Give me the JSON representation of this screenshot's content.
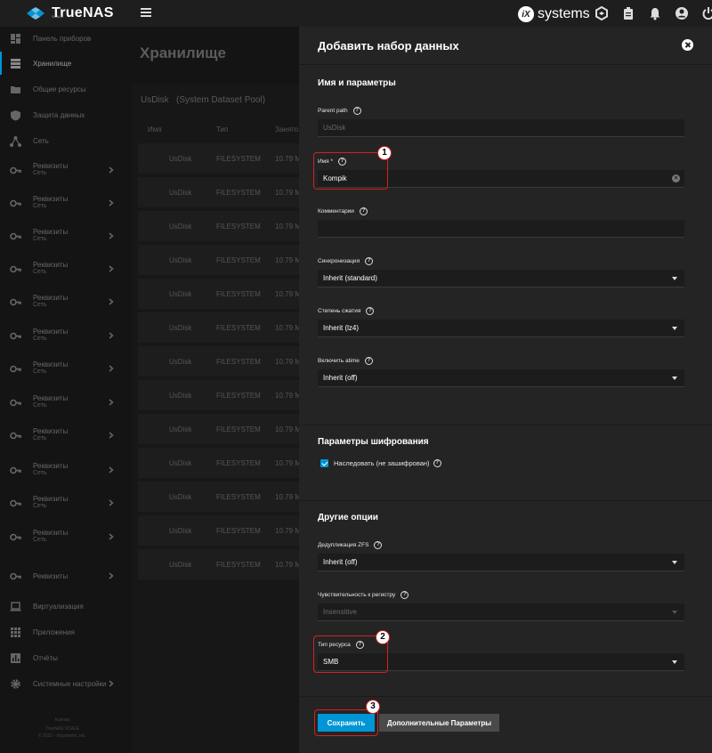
{
  "topbar": {
    "logo_text": "TrueNAS",
    "logo_sub": "SCALE",
    "brand_text": "systems",
    "brand_mark": "iX"
  },
  "sidebar": {
    "items": [
      {
        "label": "Панель приборов",
        "icon": "dashboard-icon"
      },
      {
        "label": "Хранилище",
        "icon": "storage-icon",
        "active": true
      },
      {
        "label": "Общие ресурсы",
        "icon": "shares-icon"
      },
      {
        "label": "Защита данных",
        "icon": "shield-icon"
      },
      {
        "label": "Сеть",
        "icon": "network-icon"
      },
      {
        "label": "Реквизиты",
        "sub": "Сеть",
        "icon": "key-icon"
      },
      {
        "label": "Реквизиты",
        "sub": "Сеть",
        "icon": "key-icon"
      },
      {
        "label": "Реквизиты",
        "sub": "Сеть",
        "icon": "key-icon"
      },
      {
        "label": "Реквизиты",
        "sub": "Сеть",
        "icon": "key-icon"
      },
      {
        "label": "Реквизиты",
        "sub": "Сеть",
        "icon": "key-icon"
      },
      {
        "label": "Реквизиты",
        "sub": "Сеть",
        "icon": "key-icon"
      },
      {
        "label": "Реквизиты",
        "sub": "Сеть",
        "icon": "key-icon"
      },
      {
        "label": "Реквизиты",
        "sub": "Сеть",
        "icon": "key-icon"
      },
      {
        "label": "Реквизиты",
        "sub": "Сеть",
        "icon": "key-icon"
      },
      {
        "label": "Реквизиты",
        "sub": "Сеть",
        "icon": "key-icon"
      },
      {
        "label": "Реквизиты",
        "sub": "Сеть",
        "icon": "key-icon"
      },
      {
        "label": "Реквизиты",
        "sub": "Сеть",
        "icon": "key-icon"
      },
      {
        "label": "Реквизиты",
        "icon": "key-icon"
      },
      {
        "label": "Виртуализация",
        "icon": "laptop-icon"
      },
      {
        "label": "Приложения",
        "icon": "apps-icon"
      },
      {
        "label": "Отчёты",
        "icon": "reports-icon"
      },
      {
        "label": "Системные настройки",
        "icon": "gear-icon"
      }
    ],
    "footer": [
      "truenas",
      "TrueNAS SCALE",
      "© 2022 - iXsystems, Inc."
    ]
  },
  "main": {
    "title": "Хранилище",
    "pool_name": "UsDisk",
    "pool_note": "(System Dataset Pool)",
    "columns": [
      "Имя",
      "Тип",
      "Занято"
    ],
    "rows": [
      {
        "name": "UsDisk",
        "type": "FILESYSTEM",
        "used": "10.79 M"
      },
      {
        "name": "UsDisk",
        "type": "FILESYSTEM",
        "used": "10.79 M"
      },
      {
        "name": "UsDisk",
        "type": "FILESYSTEM",
        "used": "10.79 M"
      },
      {
        "name": "UsDisk",
        "type": "FILESYSTEM",
        "used": "10.79 M"
      },
      {
        "name": "UsDisk",
        "type": "FILESYSTEM",
        "used": "10.79 M"
      },
      {
        "name": "UsDisk",
        "type": "FILESYSTEM",
        "used": "10.79 M"
      },
      {
        "name": "UsDisk",
        "type": "FILESYSTEM",
        "used": "10.79 M"
      },
      {
        "name": "UsDisk",
        "type": "FILESYSTEM",
        "used": "10.79 M"
      },
      {
        "name": "UsDisk",
        "type": "FILESYSTEM",
        "used": "10.79 M"
      },
      {
        "name": "UsDisk",
        "type": "FILESYSTEM",
        "used": "10.79 M"
      },
      {
        "name": "UsDisk",
        "type": "FILESYSTEM",
        "used": "10.79 M"
      },
      {
        "name": "UsDisk",
        "type": "FILESYSTEM",
        "used": "10.79 M"
      },
      {
        "name": "UsDisk",
        "type": "FILESYSTEM",
        "used": "10.79 M"
      }
    ]
  },
  "panel": {
    "title": "Добавить набор данных",
    "section1": "Имя и параметры",
    "parent_path_label": "Parent path",
    "parent_path_value": "UsDisk",
    "name_label": "Имя *",
    "name_value": "Kompik",
    "comments_label": "Комментарии",
    "comments_value": "",
    "sync_label": "Синхронизация",
    "sync_value": "Inherit (standard)",
    "compression_label": "Степень сжатия",
    "compression_value": "Inherit (lz4)",
    "atime_label": "Включить atime",
    "atime_value": "Inherit (off)",
    "section2": "Параметры шифрования",
    "inherit_label": "Наследовать (не зашифрован)",
    "section3": "Другие опции",
    "dedup_label": "Дедупликация ZFS",
    "dedup_value": "Inherit (off)",
    "case_label": "Чувствительность к регистру",
    "case_value": "Insensitive",
    "share_label": "Тип ресурса",
    "share_value": "SMB",
    "save_label": "Сохранить",
    "advanced_label": "Дополнительные Параметры"
  },
  "annotations": {
    "badge1": "1",
    "badge2": "2",
    "badge3": "3"
  },
  "colors": {
    "accent": "#0095d5",
    "highlight": "#d62020",
    "panel_bg": "#242424"
  }
}
